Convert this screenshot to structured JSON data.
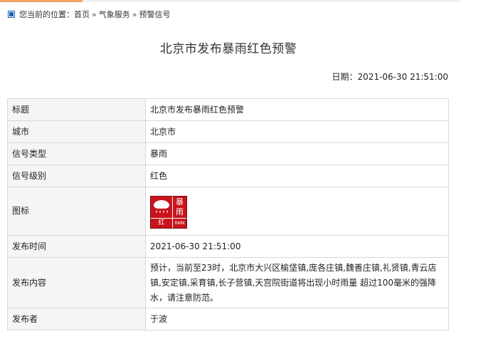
{
  "breadcrumb": {
    "prefix": "您当前的位置：",
    "items": [
      "首页",
      "气象服务",
      "预警信号"
    ],
    "separator": "»"
  },
  "page": {
    "title": "北京市发布暴雨红色预警",
    "date_label": "日期：",
    "date_value": "2021-06-30 21:51:00"
  },
  "table": {
    "rows": [
      {
        "label": "标题",
        "value": "北京市发布暴雨红色预警"
      },
      {
        "label": "城市",
        "value": "北京市"
      },
      {
        "label": "信号类型",
        "value": "暴雨"
      },
      {
        "label": "信号级别",
        "value": "红色"
      },
      {
        "label": "图标",
        "value": ""
      },
      {
        "label": "发布时间",
        "value": "2021-06-30 21:51:00"
      },
      {
        "label": "发布内容",
        "value": "预计，当前至23时，北京市大兴区榆垡镇,庞各庄镇,魏善庄镇,礼贤镇,青云店镇,安定镇,采育镇,长子营镇,天宫院街道将出现小时雨量 超过100毫米的强降水，请注意防范。"
      },
      {
        "label": "发布者",
        "value": "于波"
      }
    ]
  },
  "warning_icon": {
    "icon": "rainstorm-red-warning-icon",
    "char_top": "暴",
    "char_bottom": "雨",
    "level_char": "红",
    "english": "RAIN STORM",
    "color": "#c8141a"
  },
  "colors": {
    "accent": "#f0a268",
    "label_bg": "#f5f5f5",
    "border": "#d8d8d8",
    "breadcrumb_icon": "#1f63b5"
  }
}
